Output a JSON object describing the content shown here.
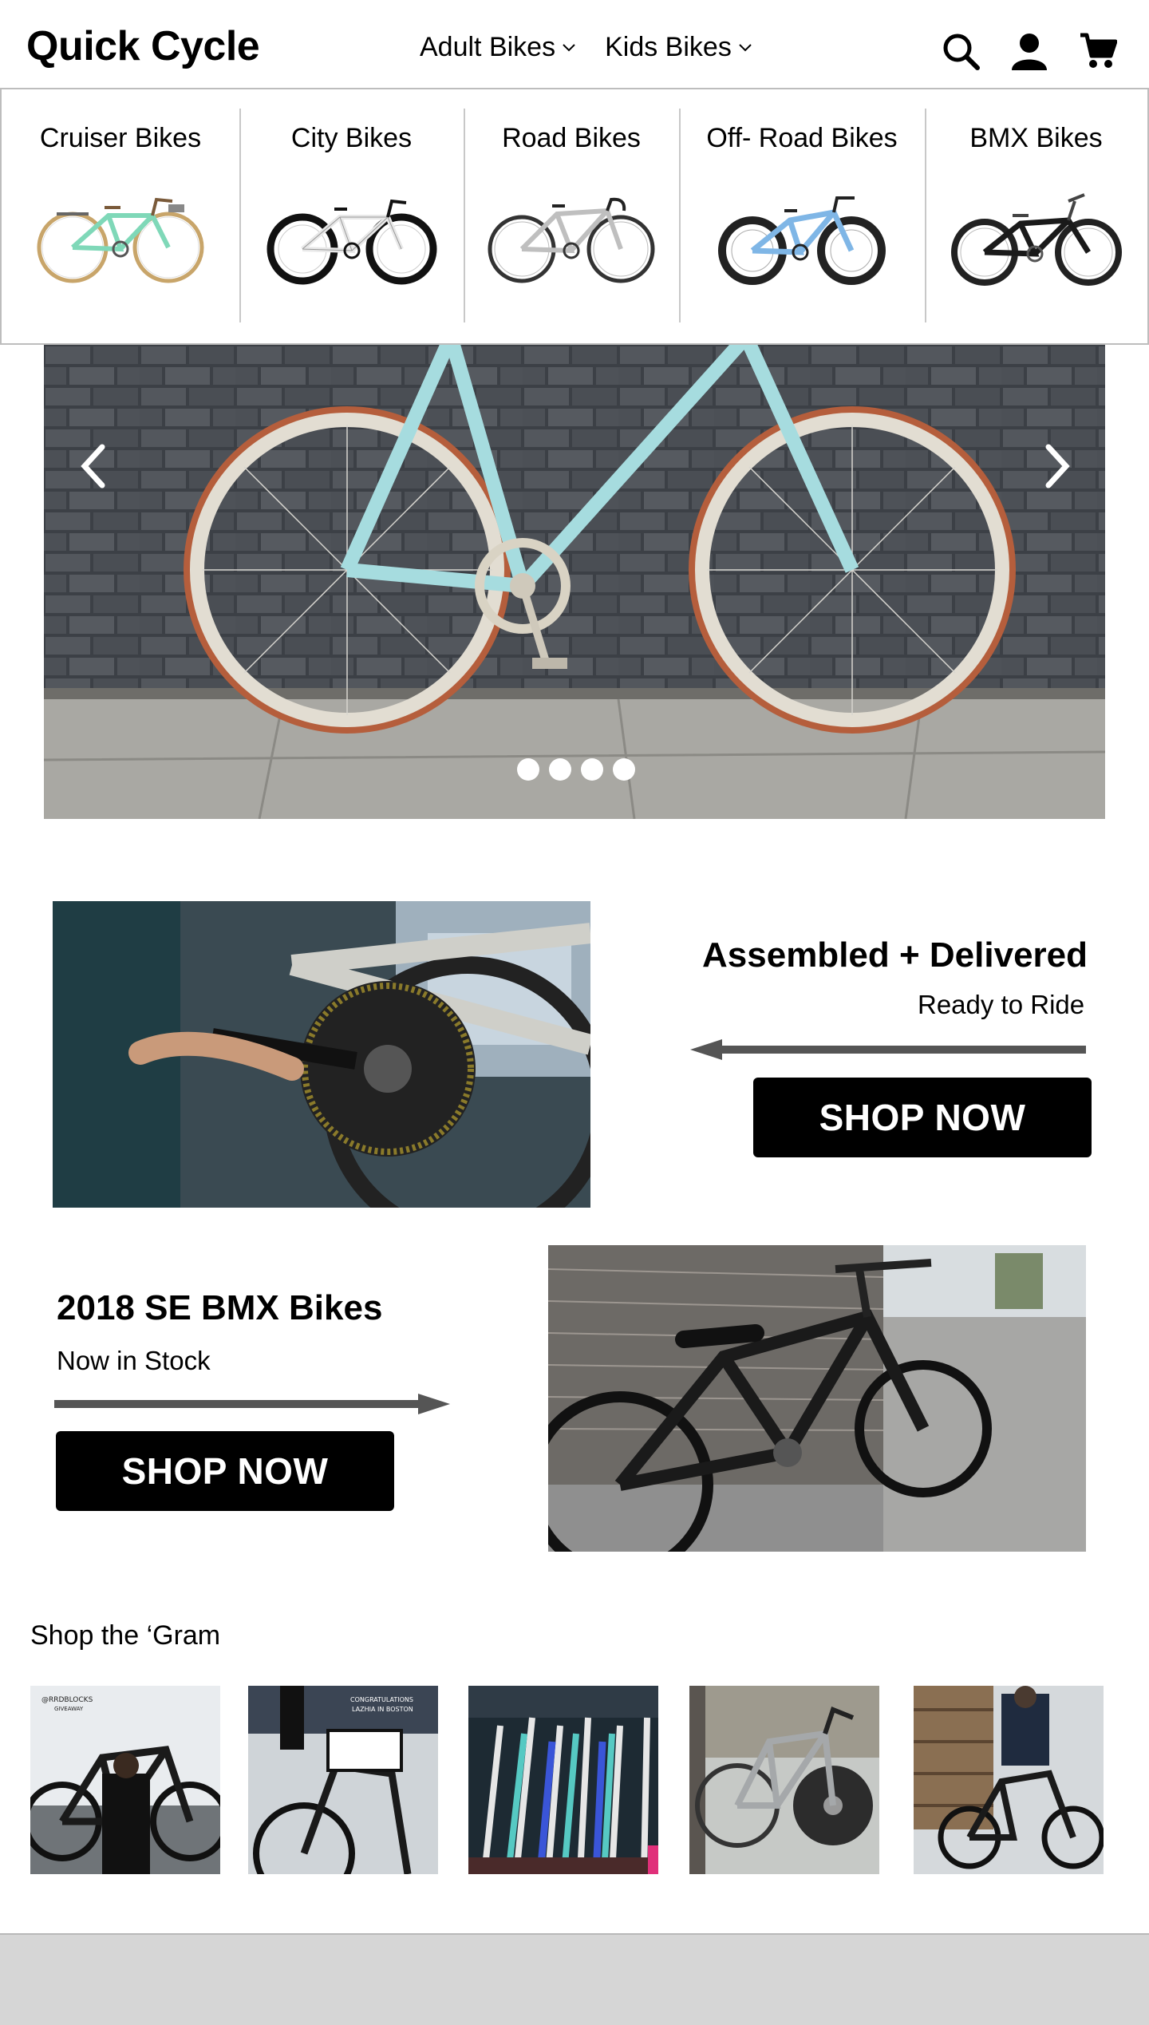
{
  "header": {
    "brand": "Quick Cycle",
    "nav": [
      {
        "label": "Adult Bikes"
      },
      {
        "label": "Kids Bikes"
      }
    ],
    "icons": [
      "search-icon",
      "account-icon",
      "cart-icon"
    ]
  },
  "megamenu": {
    "categories": [
      {
        "label": "Cruiser Bikes",
        "frame_color": "#7fd8b8"
      },
      {
        "label": "City Bikes",
        "frame_color": "#e8e8e8"
      },
      {
        "label": "Road Bikes",
        "frame_color": "#bfbfbf"
      },
      {
        "label": "Off- Road Bikes",
        "frame_color": "#7fb6e6"
      },
      {
        "label": "BMX Bikes",
        "frame_color": "#1a1a1a"
      }
    ]
  },
  "hero": {
    "slide_count": 4,
    "frame_color": "#a6dcdf",
    "icons": [
      "chevron-left-icon",
      "chevron-right-icon"
    ]
  },
  "promo1": {
    "title": "Assembled + Delivered",
    "subtitle": "Ready to Ride",
    "button": "SHOP NOW"
  },
  "promo2": {
    "title": "2018 SE BMX Bikes",
    "subtitle": "Now in Stock",
    "button": "SHOP NOW"
  },
  "gram": {
    "title": "Shop the ‘Gram",
    "posts": [
      {
        "caption_top": "@RRDBLOCKS",
        "caption_sub": "GIVEAWAY"
      },
      {
        "caption_top": "CONGRATULATIONS",
        "caption_sub": "LAZHIA IN BOSTON"
      },
      {
        "caption_top": "",
        "caption_sub": ""
      },
      {
        "caption_top": "",
        "caption_sub": ""
      },
      {
        "caption_top": "",
        "caption_sub": ""
      }
    ]
  },
  "colors": {
    "accent": "#000000",
    "footer": "#d6d6d6",
    "divider": "#c8c8c8"
  }
}
